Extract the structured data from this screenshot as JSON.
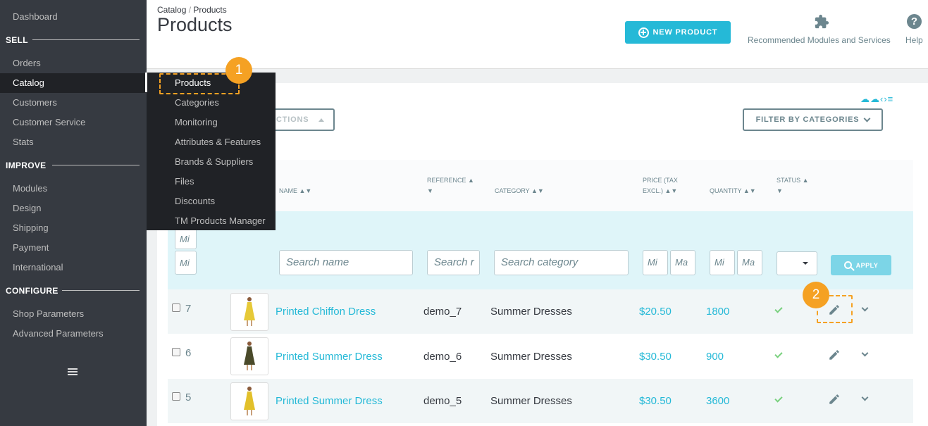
{
  "sidebar": {
    "dashboard": "Dashboard",
    "sections": {
      "sell": "SELL",
      "improve": "IMPROVE",
      "configure": "CONFIGURE"
    },
    "sell_items": [
      "Orders",
      "Catalog",
      "Customers",
      "Customer Service",
      "Stats"
    ],
    "improve_items": [
      "Modules",
      "Design",
      "Shipping",
      "Payment",
      "International"
    ],
    "configure_items": [
      "Shop Parameters",
      "Advanced Parameters"
    ],
    "active_item": "Catalog"
  },
  "submenu": {
    "items": [
      "Products",
      "Categories",
      "Monitoring",
      "Attributes & Features",
      "Brands & Suppliers",
      "Files",
      "Discounts",
      "TM Products Manager"
    ],
    "active": "Products"
  },
  "header": {
    "breadcrumb": [
      "Catalog",
      "Products"
    ],
    "title": "Products",
    "new_product_label": "NEW PRODUCT",
    "recommended_label": "Recommended Modules and Services",
    "help_label": "Help"
  },
  "toolbar": {
    "bulk_actions_label": "CTIONS",
    "filter_categories_label": "FILTER BY CATEGORIES"
  },
  "table": {
    "columns": {
      "name": "NAME ▲▼",
      "reference_1": "REFERENCE ▲",
      "reference_2": "▼",
      "category": "CATEGORY ▲▼",
      "price_1": "PRICE (TAX",
      "price_2": "EXCL.) ▲▼",
      "quantity": "QUANTITY ▲▼",
      "status_1": "STATUS ▲",
      "status_2": "▼"
    },
    "filters": {
      "id_min": "Mi",
      "id_max": "Mi",
      "name_placeholder": "Search name",
      "reference_placeholder": "Search r",
      "category_placeholder": "Search category",
      "price_min": "Mi",
      "price_max": "Ma",
      "qty_min": "Mi",
      "qty_max": "Ma",
      "apply_label": "APPLY"
    },
    "rows": [
      {
        "id": "7",
        "name": "Printed Chiffon Dress",
        "reference": "demo_7",
        "category": "Summer Dresses",
        "price": "$20.50",
        "quantity": "1800"
      },
      {
        "id": "6",
        "name": "Printed Summer Dress",
        "reference": "demo_6",
        "category": "Summer Dresses",
        "price": "$30.50",
        "quantity": "900"
      },
      {
        "id": "5",
        "name": "Printed Summer Dress",
        "reference": "demo_5",
        "category": "Summer Dresses",
        "price": "$30.50",
        "quantity": "3600"
      }
    ]
  },
  "annotations": {
    "step_1": "1",
    "step_2": "2"
  },
  "colors": {
    "accent": "#25b9d7",
    "sidebar_bg": "#363a41",
    "annotation": "#f5a123",
    "status_enabled": "#78d07d"
  }
}
